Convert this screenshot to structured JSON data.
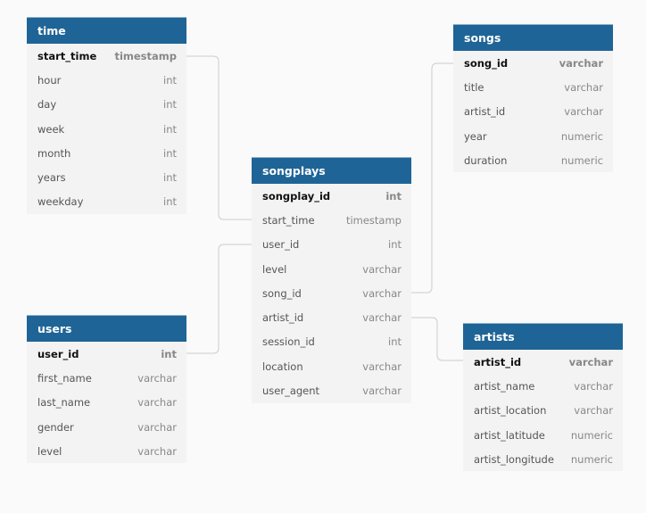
{
  "tables": {
    "time": {
      "name": "time",
      "columns": [
        [
          "start_time",
          "timestamp"
        ],
        [
          "hour",
          "int"
        ],
        [
          "day",
          "int"
        ],
        [
          "week",
          "int"
        ],
        [
          "month",
          "int"
        ],
        [
          "years",
          "int"
        ],
        [
          "weekday",
          "int"
        ]
      ]
    },
    "songs": {
      "name": "songs",
      "columns": [
        [
          "song_id",
          "varchar"
        ],
        [
          "title",
          "varchar"
        ],
        [
          "artist_id",
          "varchar"
        ],
        [
          "year",
          "numeric"
        ],
        [
          "duration",
          "numeric"
        ]
      ]
    },
    "songplays": {
      "name": "songplays",
      "columns": [
        [
          "songplay_id",
          "int"
        ],
        [
          "start_time",
          "timestamp"
        ],
        [
          "user_id",
          "int"
        ],
        [
          "level",
          "varchar"
        ],
        [
          "song_id",
          "varchar"
        ],
        [
          "artist_id",
          "varchar"
        ],
        [
          "session_id",
          "int"
        ],
        [
          "location",
          "varchar"
        ],
        [
          "user_agent",
          "varchar"
        ]
      ]
    },
    "users": {
      "name": "users",
      "columns": [
        [
          "user_id",
          "int"
        ],
        [
          "first_name",
          "varchar"
        ],
        [
          "last_name",
          "varchar"
        ],
        [
          "gender",
          "varchar"
        ],
        [
          "level",
          "varchar"
        ]
      ]
    },
    "artists": {
      "name": "artists",
      "columns": [
        [
          "artist_id",
          "varchar"
        ],
        [
          "artist_name",
          "varchar"
        ],
        [
          "artist_location",
          "varchar"
        ],
        [
          "artist_latitude",
          "numeric"
        ],
        [
          "artist_longitude",
          "numeric"
        ]
      ]
    }
  },
  "colors": {
    "header": "#1f6496",
    "connector": "#cccccc"
  }
}
